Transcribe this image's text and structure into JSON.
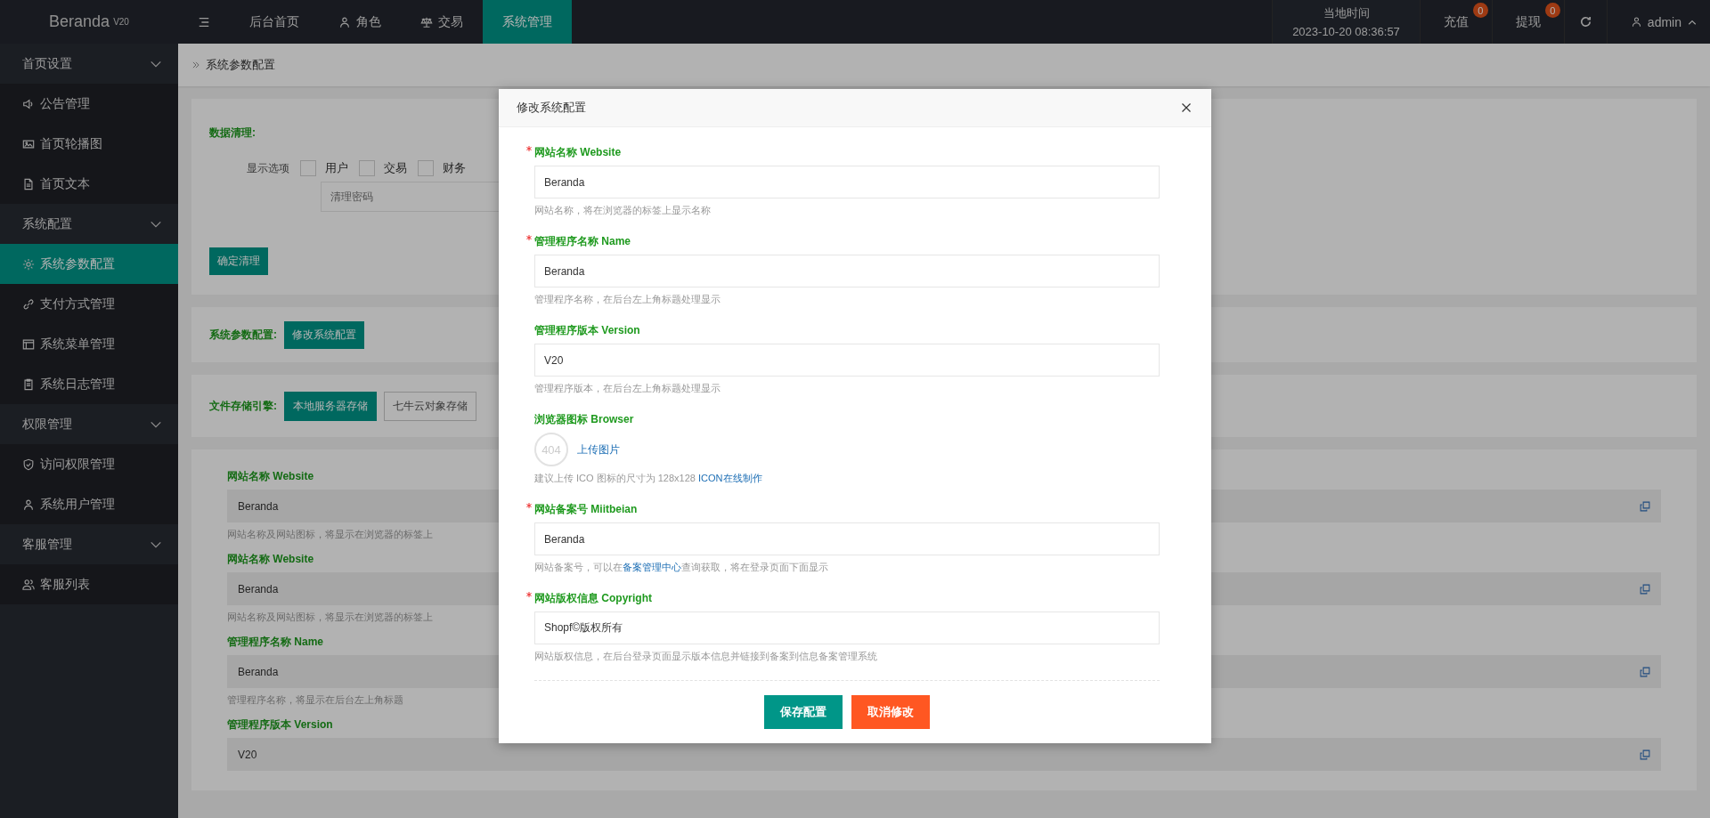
{
  "topbar": {
    "logo": "Beranda",
    "version": "V20",
    "nav": [
      {
        "label": "后台首页",
        "selected": false
      },
      {
        "label": "角色",
        "selected": false
      },
      {
        "label": "交易",
        "selected": false
      },
      {
        "label": "系统管理",
        "selected": true
      }
    ],
    "clock": {
      "label": "当地时间",
      "value": "2023-10-20 08:36:57"
    },
    "counters": [
      {
        "label": "充值",
        "badge": "0"
      },
      {
        "label": "提现",
        "badge": "0"
      }
    ],
    "user": "admin"
  },
  "sidebar": {
    "groups": [
      {
        "label": "首页设置",
        "expanded": true,
        "children": [
          {
            "label": "公告管理",
            "selected": false
          },
          {
            "label": "首页轮播图",
            "selected": false
          },
          {
            "label": "首页文本",
            "selected": false
          }
        ]
      },
      {
        "label": "系统配置",
        "expanded": true,
        "children": [
          {
            "label": "系统参数配置",
            "selected": true
          },
          {
            "label": "支付方式管理",
            "selected": false
          },
          {
            "label": "系统菜单管理",
            "selected": false
          },
          {
            "label": "系统日志管理",
            "selected": false
          }
        ]
      },
      {
        "label": "权限管理",
        "expanded": true,
        "children": [
          {
            "label": "访问权限管理",
            "selected": false
          },
          {
            "label": "系统用户管理",
            "selected": false
          }
        ]
      },
      {
        "label": "客服管理",
        "expanded": true,
        "children": [
          {
            "label": "客服列表",
            "selected": false
          }
        ]
      }
    ]
  },
  "breadcrumb": "系统参数配置",
  "cleanup": {
    "title": "数据清理:",
    "options_label": "显示选项",
    "options": [
      {
        "label": "用户",
        "checked": false
      },
      {
        "label": "交易",
        "checked": false
      },
      {
        "label": "财务",
        "checked": false
      }
    ],
    "password_placeholder": "清理密码",
    "button": "确定清理"
  },
  "params": {
    "label": "系统参数配置:",
    "button": "修改系统配置"
  },
  "storage": {
    "label": "文件存储引擎:",
    "options": [
      {
        "label": "本地服务器存储",
        "selected": true
      },
      {
        "label": "七牛云对象存储",
        "selected": false
      }
    ]
  },
  "settings_fields": [
    {
      "label": "网站名称 Website",
      "value": "Beranda",
      "hint": "网站名称及网站图标，将显示在浏览器的标签上"
    },
    {
      "label": "网站名称 Website",
      "value": "Beranda",
      "hint": "网站名称及网站图标，将显示在浏览器的标签上"
    },
    {
      "label": "管理程序名称 Name",
      "value": "Beranda",
      "hint": "管理程序名称，将显示在后台左上角标题"
    },
    {
      "label": "管理程序版本 Version",
      "value": "V20"
    }
  ],
  "modal": {
    "title": "修改系统配置",
    "fields": [
      {
        "kind": "input",
        "label": "网站名称 Website",
        "required": true,
        "value": "Beranda",
        "hint": "网站名称，将在浏览器的标签上显示名称"
      },
      {
        "kind": "input",
        "label": "管理程序名称 Name",
        "required": true,
        "value": "Beranda",
        "hint": "管理程序名称，在后台左上角标题处理显示"
      },
      {
        "kind": "input",
        "label": "管理程序版本 Version",
        "required": false,
        "value": "V20",
        "hint": "管理程序版本，在后台左上角标题处理显示"
      },
      {
        "kind": "upload",
        "label": "浏览器图标 Browser",
        "required": false,
        "preview": "404",
        "upload": "上传图片",
        "hint": "建议上传 ICO 图标的尺寸为 128x128 ",
        "hint_link": "ICON在线制作"
      },
      {
        "kind": "input",
        "label": "网站备案号 Miitbeian",
        "required": true,
        "value": "Beranda",
        "hint": "网站备案号，可以在",
        "hint_link": "备案管理中心",
        "hint_after": "查询获取，将在登录页面下面显示"
      },
      {
        "kind": "input",
        "label": "网站版权信息 Copyright",
        "required": true,
        "value": "Shopf©版权所有",
        "hint": "网站版权信息，在后台登录页面显示版本信息并链接到备案到信息备案管理系统"
      }
    ],
    "buttons": [
      {
        "label": "保存配置",
        "kind": "primary"
      },
      {
        "label": "取消修改",
        "kind": "danger"
      }
    ]
  }
}
